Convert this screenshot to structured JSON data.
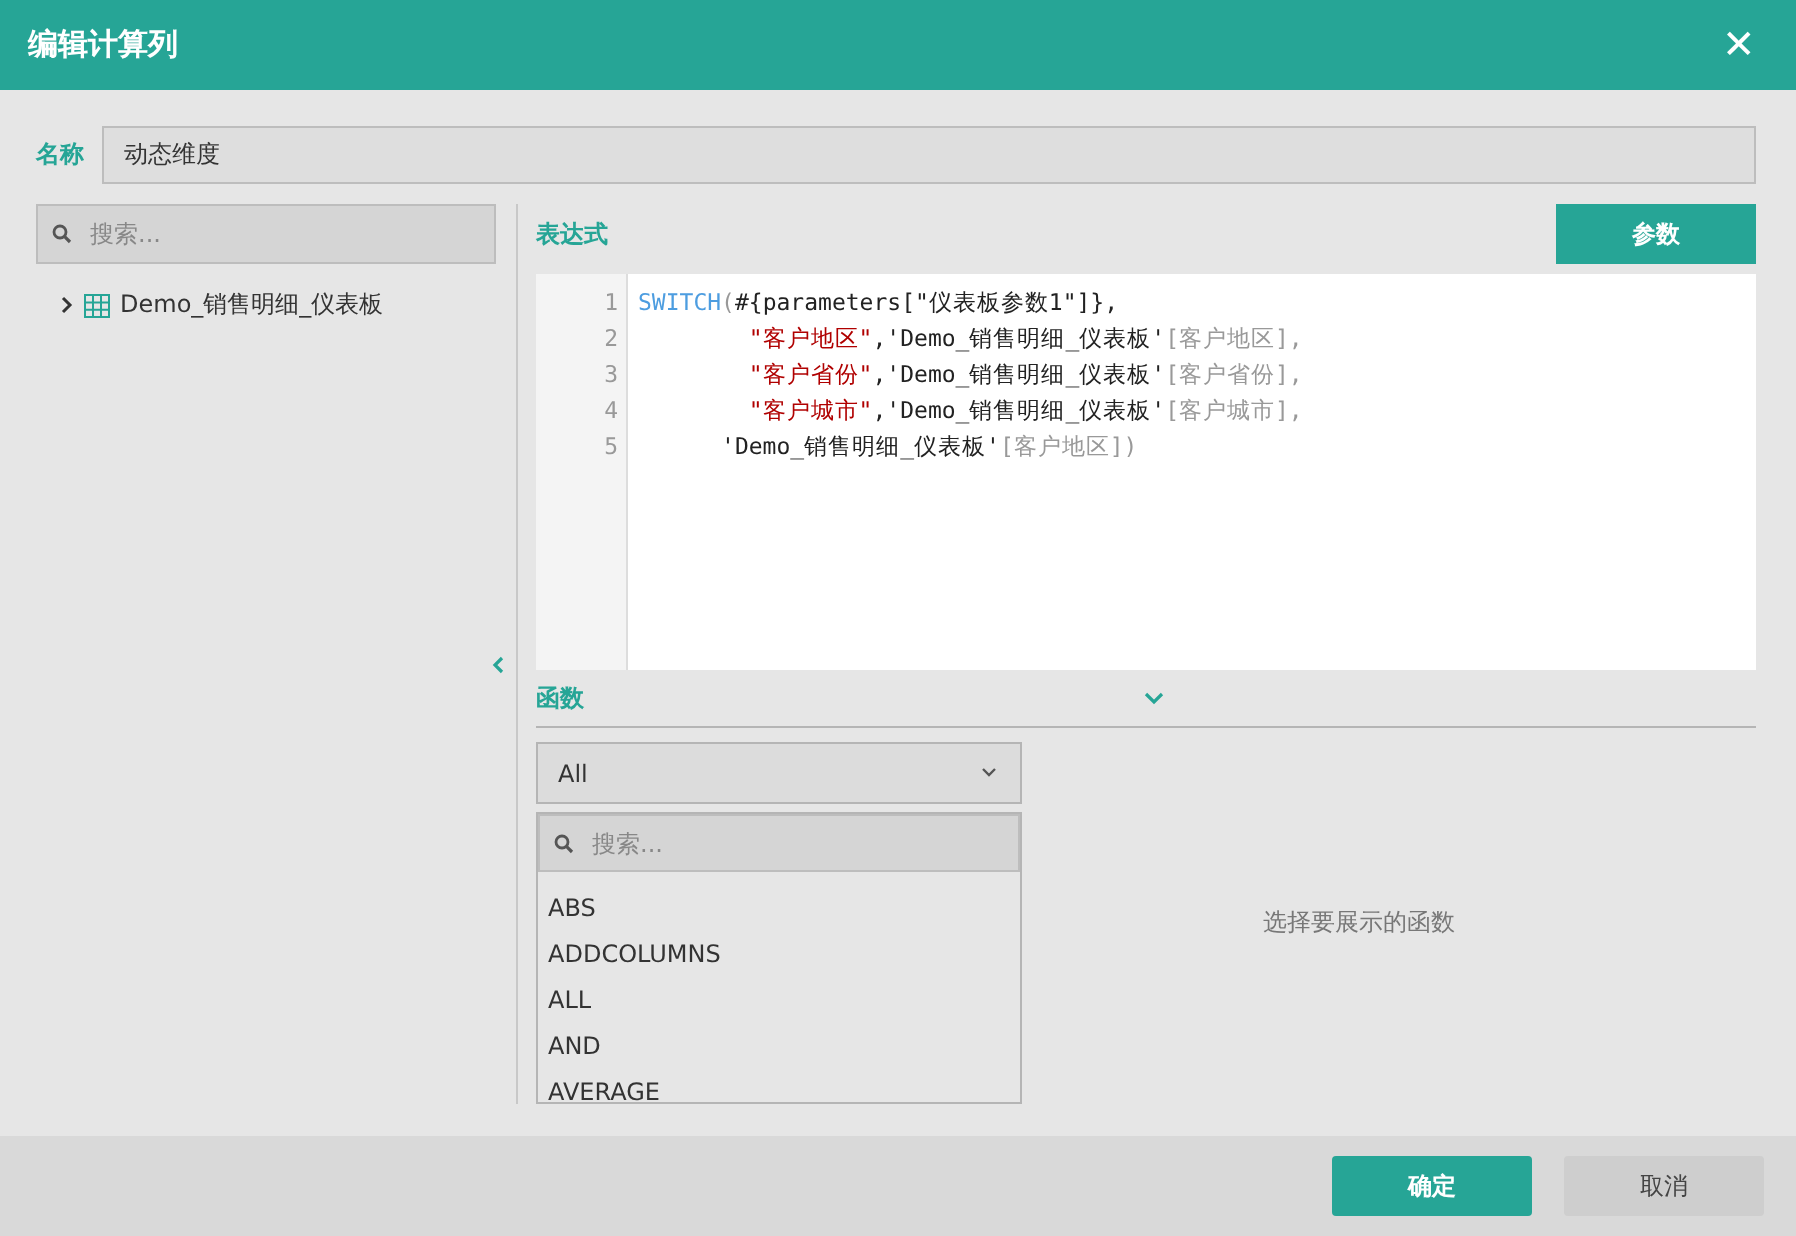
{
  "window": {
    "title": "编辑计算列",
    "close": "✕"
  },
  "name_field": {
    "label": "名称",
    "value": "动态维度"
  },
  "sidebar": {
    "search": {
      "placeholder": "搜索..."
    },
    "tree": [
      {
        "label": "Demo_销售明细_仪表板",
        "expanded": false
      }
    ]
  },
  "expression": {
    "label": "表达式",
    "param_button": "参数",
    "lines": [
      {
        "number": "1",
        "tokens": [
          {
            "kind": "keyword",
            "text": "SWITCH"
          },
          {
            "kind": "column",
            "text": "("
          },
          {
            "kind": "plain",
            "text": "#{parameters[\"仪表板参数1\"]},"
          }
        ]
      },
      {
        "number": "2",
        "tokens": [
          {
            "kind": "string",
            "text": "        \"客户地区\""
          },
          {
            "kind": "plain",
            "text": ",'Demo_销售明细_仪表板'"
          },
          {
            "kind": "column",
            "text": "[客户地区],"
          }
        ]
      },
      {
        "number": "3",
        "tokens": [
          {
            "kind": "string",
            "text": "        \"客户省份\""
          },
          {
            "kind": "plain",
            "text": ",'Demo_销售明细_仪表板'"
          },
          {
            "kind": "column",
            "text": "[客户省份],"
          }
        ]
      },
      {
        "number": "4",
        "tokens": [
          {
            "kind": "string",
            "text": "        \"客户城市\""
          },
          {
            "kind": "plain",
            "text": ",'Demo_销售明细_仪表板'"
          },
          {
            "kind": "column",
            "text": "[客户城市],"
          }
        ]
      },
      {
        "number": "5",
        "tokens": [
          {
            "kind": "plain",
            "text": "      'Demo_销售明细_仪表板'"
          },
          {
            "kind": "column",
            "text": "[客户地区])"
          }
        ]
      }
    ]
  },
  "functions": {
    "label": "函数",
    "category": "All",
    "search": {
      "placeholder": "搜索..."
    },
    "items": [
      "ABS",
      "ADDCOLUMNS",
      "ALL",
      "AND",
      "AVERAGE"
    ],
    "hint": "选择要展示的函数"
  },
  "buttons": [
    {
      "label": "确定",
      "kind": "primary"
    },
    {
      "label": "取消",
      "kind": "secondary"
    }
  ]
}
